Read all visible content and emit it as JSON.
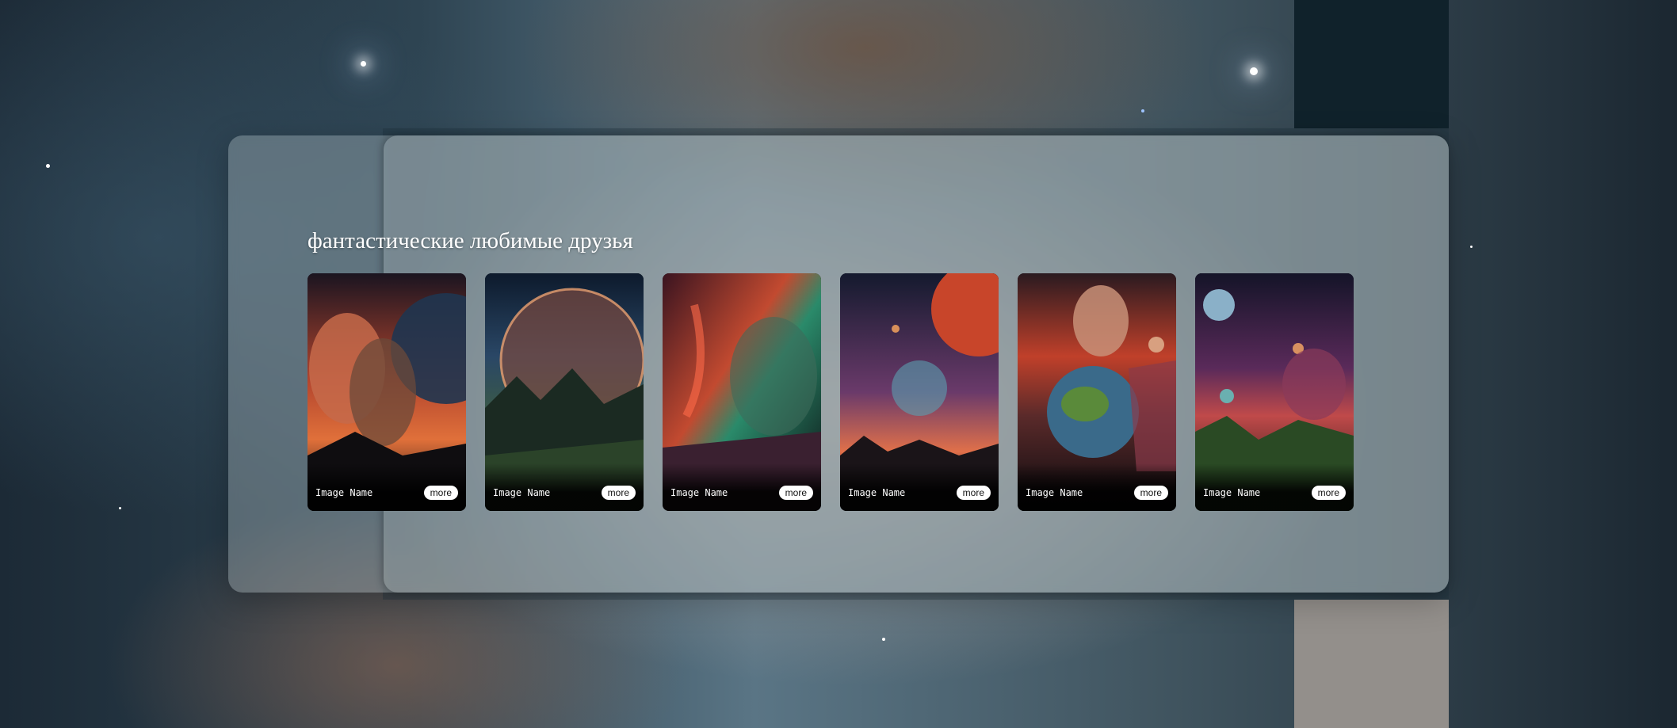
{
  "gallery": {
    "title": "фантастические любимые друзья",
    "cards": [
      {
        "name": "Image Name",
        "more_label": "more",
        "art": "portrait-man-planet"
      },
      {
        "name": "Image Name",
        "more_label": "more",
        "art": "planet-mountains-face"
      },
      {
        "name": "Image Name",
        "more_label": "more",
        "art": "aurora-woman-face"
      },
      {
        "name": "Image Name",
        "more_label": "more",
        "art": "red-planet-nebula"
      },
      {
        "name": "Image Name",
        "more_label": "more",
        "art": "man-earth-globe"
      },
      {
        "name": "Image Name",
        "more_label": "more",
        "art": "moons-purple-sky"
      }
    ]
  },
  "colors": {
    "panel": "#c8d2d7",
    "button_bg": "#ffffff",
    "title_text": "#ffffff",
    "deco_top": "#10222b",
    "deco_bottom": "#938f8b"
  }
}
